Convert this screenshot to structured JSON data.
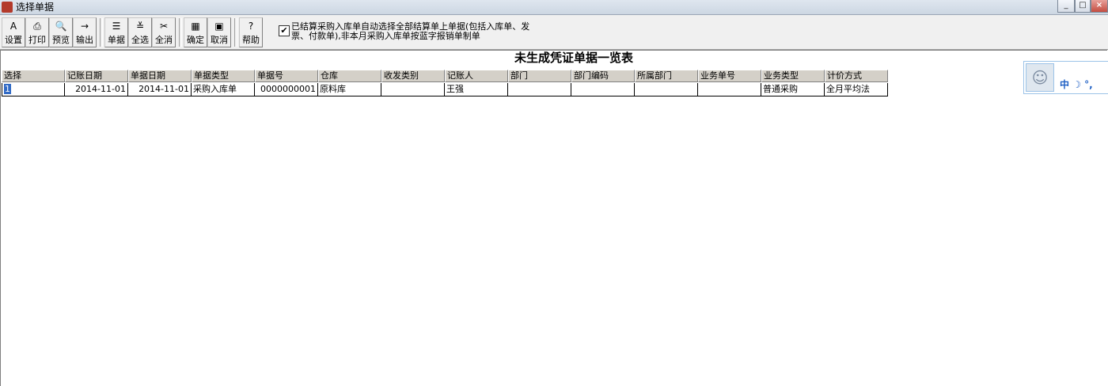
{
  "window": {
    "title": "选择单据",
    "min": "_",
    "max": "□",
    "close": "×"
  },
  "toolbar": {
    "buttons": [
      {
        "label": "设置",
        "icon": "A"
      },
      {
        "label": "打印",
        "icon": "⎙"
      },
      {
        "label": "预览",
        "icon": "🔍"
      },
      {
        "label": "输出",
        "icon": "→"
      },
      {
        "label": "单据",
        "icon": "☰"
      },
      {
        "label": "全选",
        "icon": "≚"
      },
      {
        "label": "全消",
        "icon": "✂"
      },
      {
        "label": "确定",
        "icon": "▦"
      },
      {
        "label": "取消",
        "icon": "▣"
      },
      {
        "label": "帮助",
        "icon": "?"
      }
    ],
    "auto_select_checked": "✔",
    "auto_select_text": "已结算采购入库单自动选择全部结算单上单据(包括入库单、发票、付款单),非本月采购入库单按蓝字报销单制单"
  },
  "page_title": "未生成凭证单据一览表",
  "table": {
    "columns": [
      "选择",
      "记账日期",
      "单据日期",
      "单据类型",
      "单据号",
      "仓库",
      "收发类别",
      "记账人",
      "部门",
      "部门编码",
      "所属部门",
      "业务单号",
      "业务类型",
      "计价方式"
    ],
    "rows": [
      [
        "1",
        "2014-11-01",
        "2014-11-01",
        "采购入库单",
        "0000000001",
        "原料库",
        "",
        "王强",
        "",
        "",
        "",
        "",
        "普通采购",
        "全月平均法"
      ]
    ]
  },
  "qq_widget": {
    "status_text": "中 ☽ °,"
  }
}
